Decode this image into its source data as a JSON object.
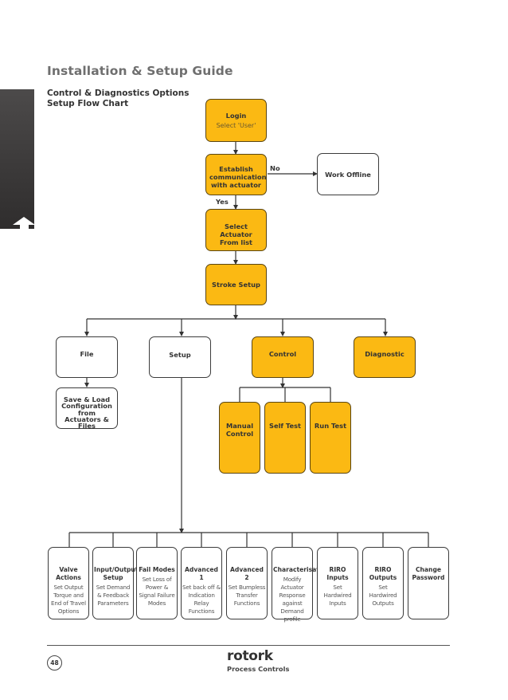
{
  "header": {
    "title": "Installation & Setup Guide",
    "subtitle_line1": "Control & Diagnostics Options",
    "subtitle_line2": "Setup Flow Chart"
  },
  "side_tab": {
    "icon": "up-arrow-icon"
  },
  "colors": {
    "highlight_fill": "#fbb913",
    "plain_fill": "#ffffff",
    "stroke": "#3b3b3b"
  },
  "flowchart": {
    "login": {
      "title": "Login",
      "subtitle": "Select 'User'"
    },
    "establish": {
      "title": "Establish communication with actuator"
    },
    "edge_no": "No",
    "edge_yes": "Yes",
    "work_offline": {
      "title": "Work Offline"
    },
    "select_actuator": {
      "title": "Select Actuator From list"
    },
    "stroke_setup": {
      "title": "Stroke Setup"
    },
    "file": {
      "title": "File"
    },
    "save_load": {
      "title": "Save & Load Configuration from Actuators & Files"
    },
    "setup": {
      "title": "Setup"
    },
    "control": {
      "title": "Control"
    },
    "diagnostic": {
      "title": "Diagnostic"
    },
    "manual_control": {
      "title": "Manual Control"
    },
    "self_test": {
      "title": "Self Test"
    },
    "run_test": {
      "title": "Run Test"
    },
    "setup_items": [
      {
        "title": "Valve Actions",
        "subtitle": "Set Output Torque and End of Travel Options"
      },
      {
        "title": "Input/Output Setup",
        "subtitle": "Set Demand & Feedback Parameters"
      },
      {
        "title": "Fail Modes",
        "subtitle": "Set Loss of Power & Signal Failure Modes"
      },
      {
        "title": "Advanced 1",
        "subtitle": "Set back off & Indication Relay Functions"
      },
      {
        "title": "Advanced 2",
        "subtitle": "Set Bumpless Transfer Functions"
      },
      {
        "title": "Characterisation",
        "subtitle": "Modify Actuator Response against Demand profile"
      },
      {
        "title": "RIRO Inputs",
        "subtitle": "Set Hardwired Inputs"
      },
      {
        "title": "RIRO Outputs",
        "subtitle": "Set Hardwired Outputs"
      },
      {
        "title": "Change Password",
        "subtitle": ""
      }
    ]
  },
  "footer": {
    "page_number": "48",
    "brand": "rotork",
    "brand_sub": "Process Controls"
  }
}
